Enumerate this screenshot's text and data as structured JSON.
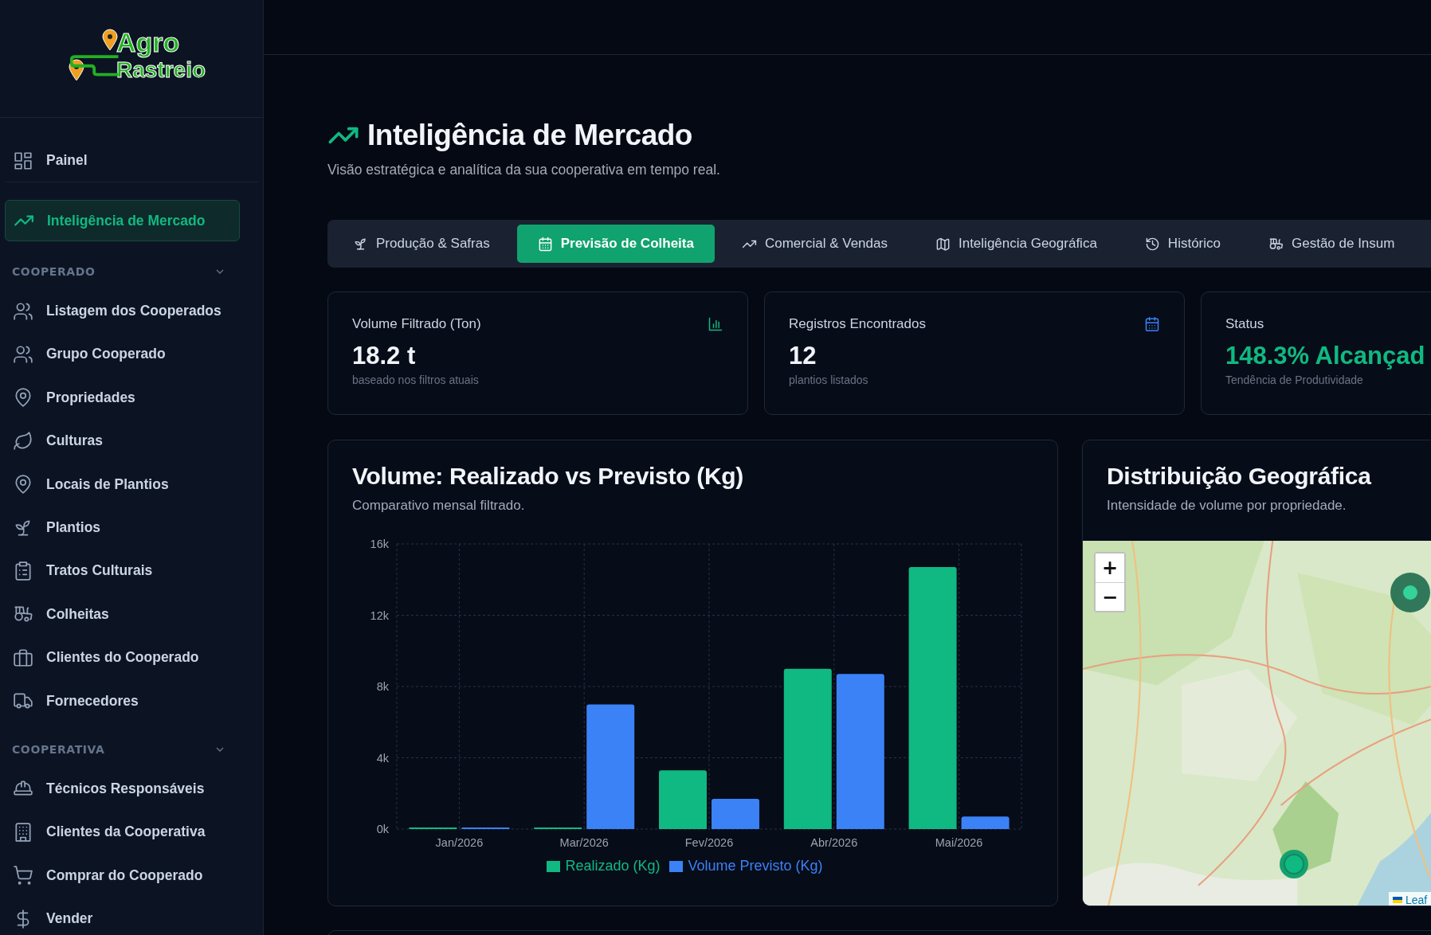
{
  "logo": {
    "line_1": "Agro",
    "line_2": "Rastreio"
  },
  "sidebar": {
    "top_items": [
      {
        "label": "Painel",
        "selected": false
      },
      {
        "label": "Inteligência de Mercado",
        "selected": true
      }
    ],
    "sections": [
      {
        "title": "COOPERADO",
        "expanded": true,
        "items": [
          {
            "label": "Listagem dos Cooperados",
            "selected": false
          },
          {
            "label": "Grupo Cooperado",
            "selected": false
          },
          {
            "label": "Propriedades",
            "selected": false
          },
          {
            "label": "Culturas",
            "selected": false
          },
          {
            "label": "Locais de Plantios",
            "selected": false
          },
          {
            "label": "Plantios",
            "selected": false
          },
          {
            "label": "Tratos Culturais",
            "selected": false
          },
          {
            "label": "Colheitas",
            "selected": false
          },
          {
            "label": "Clientes do Cooperado",
            "selected": false
          },
          {
            "label": "Fornecedores",
            "selected": false
          }
        ]
      },
      {
        "title": "COOPERATIVA",
        "expanded": true,
        "items": [
          {
            "label": "Técnicos Responsáveis",
            "selected": false
          },
          {
            "label": "Clientes da Cooperativa",
            "selected": false
          },
          {
            "label": "Comprar do Cooperado",
            "selected": false
          },
          {
            "label": "Vender",
            "selected": false
          }
        ]
      }
    ]
  },
  "page": {
    "title": "Inteligência de Mercado",
    "subtitle": "Visão estratégica e analítica da sua cooperativa em tempo real."
  },
  "tabs": [
    {
      "label": "Produção & Safras",
      "selected": false
    },
    {
      "label": "Previsão de Colheita",
      "selected": true
    },
    {
      "label": "Comercial & Vendas",
      "selected": false
    },
    {
      "label": "Inteligência Geográfica",
      "selected": false
    },
    {
      "label": "Histórico",
      "selected": false
    },
    {
      "label": "Gestão de Insum",
      "selected": false
    }
  ],
  "stats": [
    {
      "kind": "volume",
      "label": "Volume Filtrado (Ton)",
      "value": "18.2 t",
      "caption": "baseado nos filtros atuais"
    },
    {
      "kind": "records",
      "label": "Registros Encontrados",
      "value": "12",
      "caption": "plantios listados"
    },
    {
      "kind": "status",
      "label": "Status",
      "value": "148.3% Alcançad",
      "caption": "Tendência de Produtividade"
    }
  ],
  "chart_card": {
    "title": "Volume: Realizado vs Previsto (Kg)",
    "subtitle": "Comparativo mensal filtrado.",
    "chart_data": {
      "type": "bar",
      "categories": [
        "Jan/2026",
        "Mar/2026",
        "Fev/2026",
        "Abr/2026",
        "Mai/2026"
      ],
      "series": [
        {
          "name": "Realizado (Kg)",
          "color": "#10b981",
          "values": [
            0,
            30,
            3300,
            9000,
            14700
          ]
        },
        {
          "name": "Volume Previsto (Kg)",
          "color": "#3b82f6",
          "values": [
            50,
            7000,
            1700,
            8700,
            700
          ]
        }
      ],
      "ylim": [
        0,
        16000
      ],
      "grid": true,
      "legend": true,
      "yticks": [
        {
          "value": 0,
          "label": "0k"
        },
        {
          "value": 4000,
          "label": "4k"
        },
        {
          "value": 8000,
          "label": "8k"
        },
        {
          "value": 12000,
          "label": "12k"
        },
        {
          "value": 16000,
          "label": "16k"
        }
      ]
    }
  },
  "map_card": {
    "title": "Distribuição Geográfica",
    "subtitle": "Intensidade de volume por propriedade.",
    "map": {
      "kind": "picture",
      "zoom_in": "+",
      "zoom_out": "−",
      "attribution": "Leaf"
    }
  }
}
